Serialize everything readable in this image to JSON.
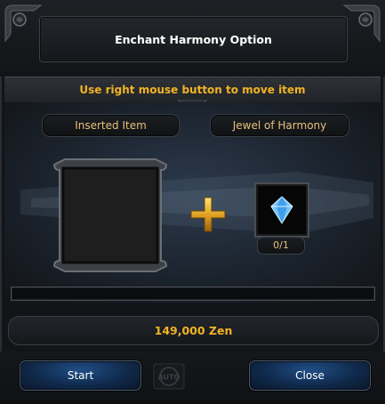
{
  "window": {
    "title": "Enchant Harmony Option",
    "hint": "Use right mouse button to move item"
  },
  "slots": {
    "inserted_label": "Inserted Item",
    "jewel_label": "Jewel of Harmony",
    "jewel_count": "0/1"
  },
  "progress": {
    "fraction": 0
  },
  "zen": {
    "amount": "149,000 Zen"
  },
  "buttons": {
    "start": "Start",
    "close": "Close",
    "auto": "AUTO"
  },
  "colors": {
    "gold_text": "#f2b324",
    "label_text": "#e9c07a",
    "button_blue": "#1f4e86",
    "jewel_blue": "#6fc3ff"
  },
  "icons": [
    "corner-ornament-icon",
    "plus-icon",
    "jewel-of-harmony-icon",
    "auto-icon"
  ]
}
